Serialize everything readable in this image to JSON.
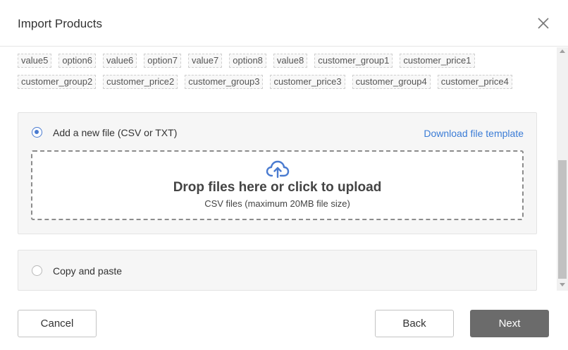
{
  "dialog": {
    "title": "Import Products"
  },
  "columns": {
    "row1": [
      "value5",
      "option6",
      "value6",
      "option7",
      "value7",
      "option8",
      "value8",
      "customer_group1",
      "customer_price1"
    ],
    "row2": [
      "customer_group2",
      "customer_price2",
      "customer_group3",
      "customer_price3",
      "customer_group4",
      "customer_price4"
    ]
  },
  "upload_option": {
    "label": "Add a new file (CSV or TXT)",
    "selected": true,
    "template_link": "Download file template",
    "dropzone": {
      "icon": "cloud-upload-icon",
      "title": "Drop files here or click to upload",
      "subtitle": "CSV files (maximum 20MB file size)"
    }
  },
  "paste_option": {
    "label": "Copy and paste",
    "selected": false
  },
  "footer": {
    "cancel": "Cancel",
    "back": "Back",
    "next": "Next"
  },
  "colors": {
    "accent": "#4a7bd0",
    "link": "#3b7cd6",
    "primary_button": "#6b6b6b"
  }
}
